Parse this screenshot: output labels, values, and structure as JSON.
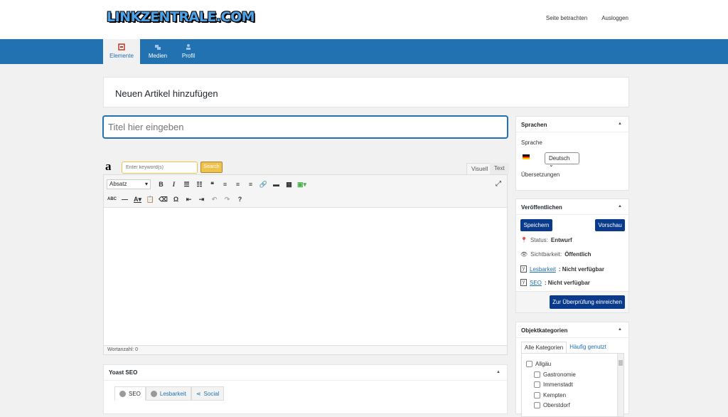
{
  "header": {
    "logo": "LINKZENTRALE.COM",
    "links": [
      "Seite betrachten",
      "Ausloggen"
    ]
  },
  "nav": {
    "tabs": [
      {
        "label": "Elemente",
        "icon": "elements-icon"
      },
      {
        "label": "Medien",
        "icon": "media-icon"
      },
      {
        "label": "Profil",
        "icon": "profile-icon"
      }
    ],
    "active": "Elemente",
    "bar_color": "#2271b1"
  },
  "page": {
    "title": "Neuen Artikel hinzufügen",
    "title_placeholder": "Titel hier eingeben"
  },
  "amazon": {
    "logo": "a",
    "keyword_placeholder": "Enter keyword(s)",
    "search_label": "Search",
    "button_color": "#f0c14b"
  },
  "editor": {
    "tabs": [
      "Visuell",
      "Text"
    ],
    "format": "Absatz",
    "wordcount": "Wortanzahl: 0"
  },
  "yoast": {
    "title": "Yoast SEO",
    "tabs": [
      "SEO",
      "Lesbarkeit",
      "Social"
    ]
  },
  "sprachen": {
    "title": "Sprachen",
    "language_label": "Sprache",
    "selected": "Deutsch",
    "translations_label": "Übersetzungen"
  },
  "publish": {
    "title": "Veröffentlichen",
    "save": "Speichern",
    "preview": "Vorschau",
    "status_label": "Status:",
    "status_value": "Entwurf",
    "visibility_label": "Sichtbarkeit:",
    "visibility_value": "Öffentlich",
    "readability_link": "Lesbarkeit",
    "readability_value": ": Nicht verfügbar",
    "seo_link": "SEO",
    "seo_value": ": Nicht verfügbar",
    "submit": "Zur Überprüfung einreichen",
    "button_color": "#0a3a8c"
  },
  "categories": {
    "title": "Objektkategorien",
    "tabs": [
      "Alle Kategorien",
      "Häufig genutzt"
    ],
    "items": [
      "Allgäu",
      "Gastronomie",
      "Immenstadt",
      "Kempten",
      "Oberstdorf"
    ]
  }
}
